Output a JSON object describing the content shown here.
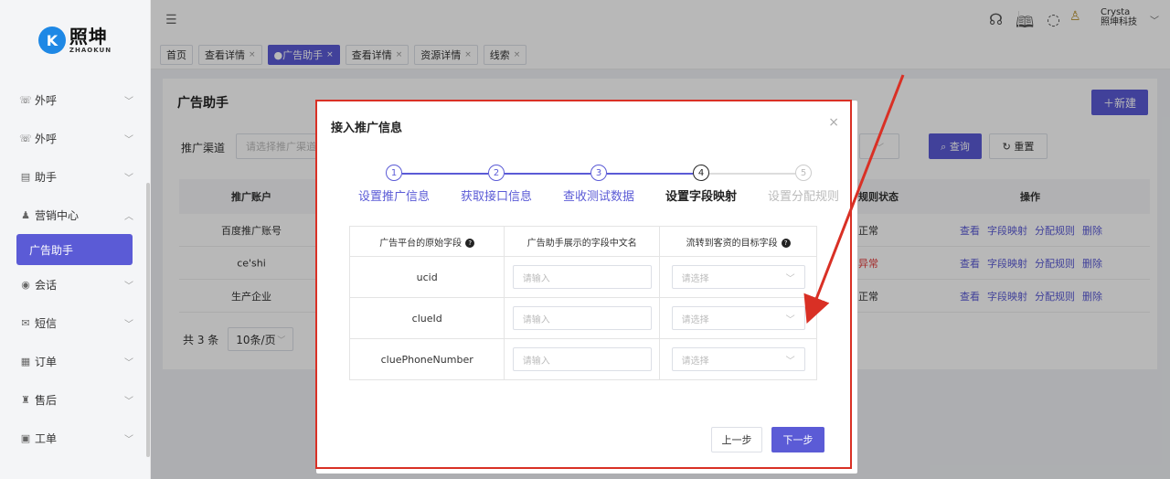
{
  "logo": {
    "cn": "照坤",
    "en": "ZHAOKUN",
    "mark": "K"
  },
  "sidebar": {
    "items": [
      {
        "label": "外呼",
        "icon": "phone-icon",
        "glyph": "☏",
        "chev": "﹀"
      },
      {
        "label": "外呼",
        "icon": "phone-icon",
        "glyph": "☏",
        "chev": "﹀"
      },
      {
        "label": "助手",
        "icon": "chart-icon",
        "glyph": "▤",
        "chev": "﹀"
      },
      {
        "label": "营销中心",
        "icon": "user-icon",
        "glyph": "♟",
        "chev": "︿"
      }
    ],
    "active_sub": "广告助手",
    "items2": [
      {
        "label": "会话",
        "icon": "chat-icon",
        "glyph": "◉",
        "chev": "﹀"
      },
      {
        "label": "短信",
        "icon": "mail-icon",
        "glyph": "✉",
        "chev": "﹀"
      },
      {
        "label": "订单",
        "icon": "order-icon",
        "glyph": "▦",
        "chev": "﹀"
      },
      {
        "label": "售后",
        "icon": "service-icon",
        "glyph": "♜",
        "chev": "﹀"
      },
      {
        "label": "工单",
        "icon": "ticket-icon",
        "glyph": "▣",
        "chev": "﹀"
      }
    ]
  },
  "topbar": {
    "collapse_glyph": "☰",
    "icons": [
      {
        "name": "headset-icon",
        "glyph": "☊"
      },
      {
        "name": "book-icon",
        "glyph": "🕮"
      },
      {
        "name": "message-icon",
        "glyph": "◌"
      }
    ],
    "user_name": "Crysta",
    "user_company": "照坤科技",
    "avatar_glyph": "♙",
    "chev": "﹀"
  },
  "tabs": [
    {
      "label": "首页",
      "close": ""
    },
    {
      "label": "查看详情",
      "close": "×"
    },
    {
      "label": "●广告助手",
      "close": "×",
      "active": true
    },
    {
      "label": "查看详情",
      "close": "×"
    },
    {
      "label": "资源详情",
      "close": "×"
    },
    {
      "label": "线索",
      "close": "×"
    }
  ],
  "main": {
    "title": "广告助手",
    "new_button": "＋新建",
    "filter_label": "推广渠道",
    "filter_placeholder": "请选择推广渠道",
    "select_chev": "﹀",
    "query_button": "⌕ 查询",
    "reset_button": "↻ 重置",
    "table": {
      "col_account": "推广账户",
      "col_status": "规则状态",
      "col_ops": "操作",
      "rows": [
        {
          "account": "百度推广账号",
          "status": "正常",
          "status_type": "ok"
        },
        {
          "account": "ce'shi",
          "status": "异常",
          "status_type": "bad"
        },
        {
          "account": "生产企业",
          "status": "正常",
          "status_type": "ok"
        }
      ],
      "ops": [
        "查看",
        "字段映射",
        "分配规则",
        "删除"
      ]
    },
    "pager": {
      "total": "共 3 条",
      "size": "10条/页",
      "chev": "﹀"
    }
  },
  "modal": {
    "title": "接入推广信息",
    "close": "×",
    "steps": [
      {
        "num": "1",
        "label": "设置推广信息",
        "state": "done"
      },
      {
        "num": "2",
        "label": "获取接口信息",
        "state": "done"
      },
      {
        "num": "3",
        "label": "查收测试数据",
        "state": "done"
      },
      {
        "num": "4",
        "label": "设置字段映射",
        "state": "current"
      },
      {
        "num": "5",
        "label": "设置分配规则",
        "state": "todo"
      }
    ],
    "table": {
      "headers": [
        "广告平台的原始字段",
        "广告助手展示的字段中文名",
        "流转到客资的目标字段"
      ],
      "help": "?",
      "rows": [
        {
          "field": "ucid",
          "input_placeholder": "请输入",
          "select_placeholder": "请选择"
        },
        {
          "field": "clueId",
          "input_placeholder": "请输入",
          "select_placeholder": "请选择"
        },
        {
          "field": "cluePhoneNumber",
          "input_placeholder": "请输入",
          "select_placeholder": "请选择"
        }
      ],
      "chev": "﹀"
    },
    "prev_button": "上一步",
    "next_button": "下一步"
  },
  "colors": {
    "accent": "#5b5bd6",
    "highlight": "#d93025",
    "error": "#e23b3b"
  }
}
